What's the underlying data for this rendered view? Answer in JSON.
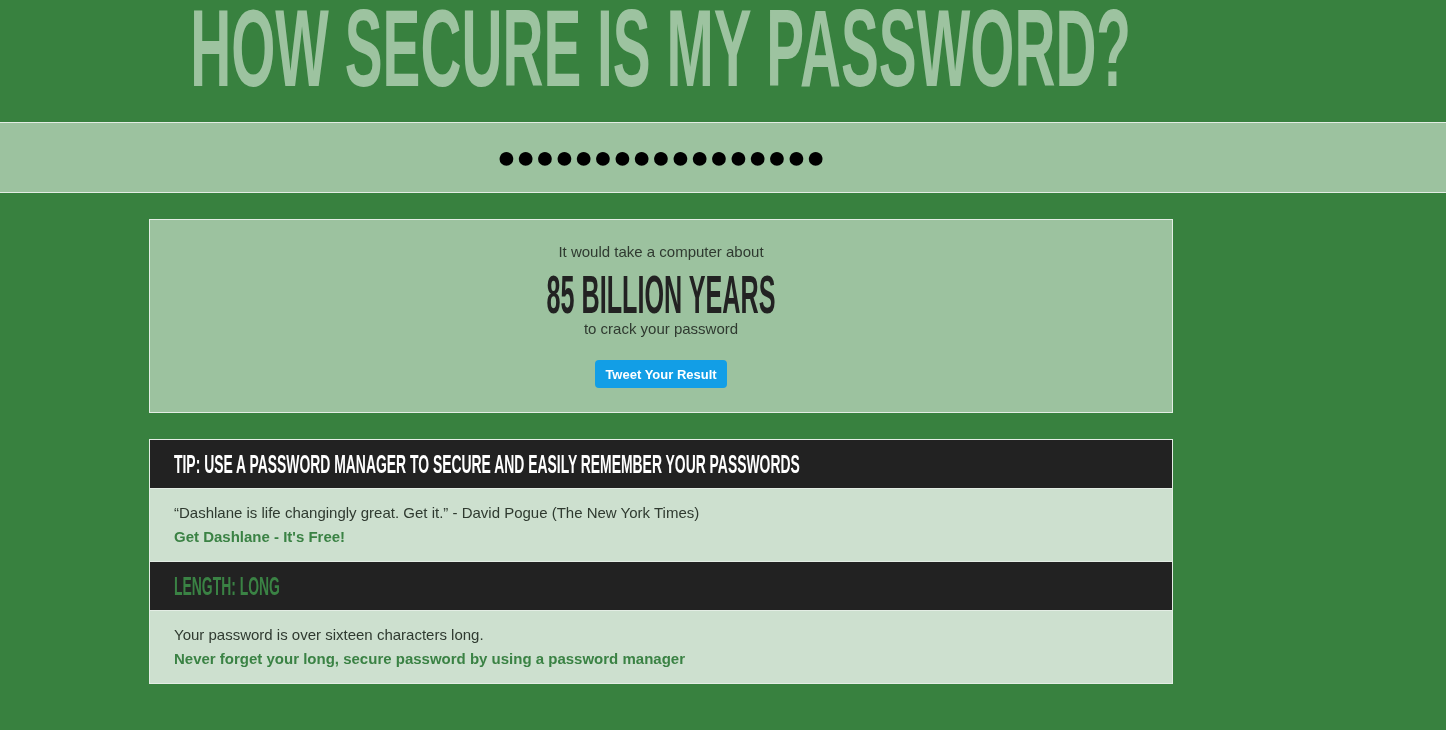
{
  "page": {
    "title": "HOW SECURE IS MY PASSWORD?"
  },
  "password_field": {
    "value": "●●●●●●●●●●●●●●●●●"
  },
  "result": {
    "intro": "It would take a computer about",
    "time": "85 BILLION YEARS",
    "outro": "to crack your password",
    "button": "Tweet Your Result"
  },
  "sections": [
    {
      "kind": "tip",
      "heading": "TIP: USE A PASSWORD MANAGER TO SECURE AND EASILY REMEMBER YOUR PASSWORDS",
      "text": "“Dashlane is life changingly great. Get it.” - David Pogue (The New York Times)",
      "link": "Get Dashlane - It's Free!"
    },
    {
      "kind": "achievement",
      "heading": "LENGTH: LONG",
      "text": "Your password is over sixteen characters long.",
      "link": "Never forget your long, secure password by using a password manager"
    }
  ]
}
